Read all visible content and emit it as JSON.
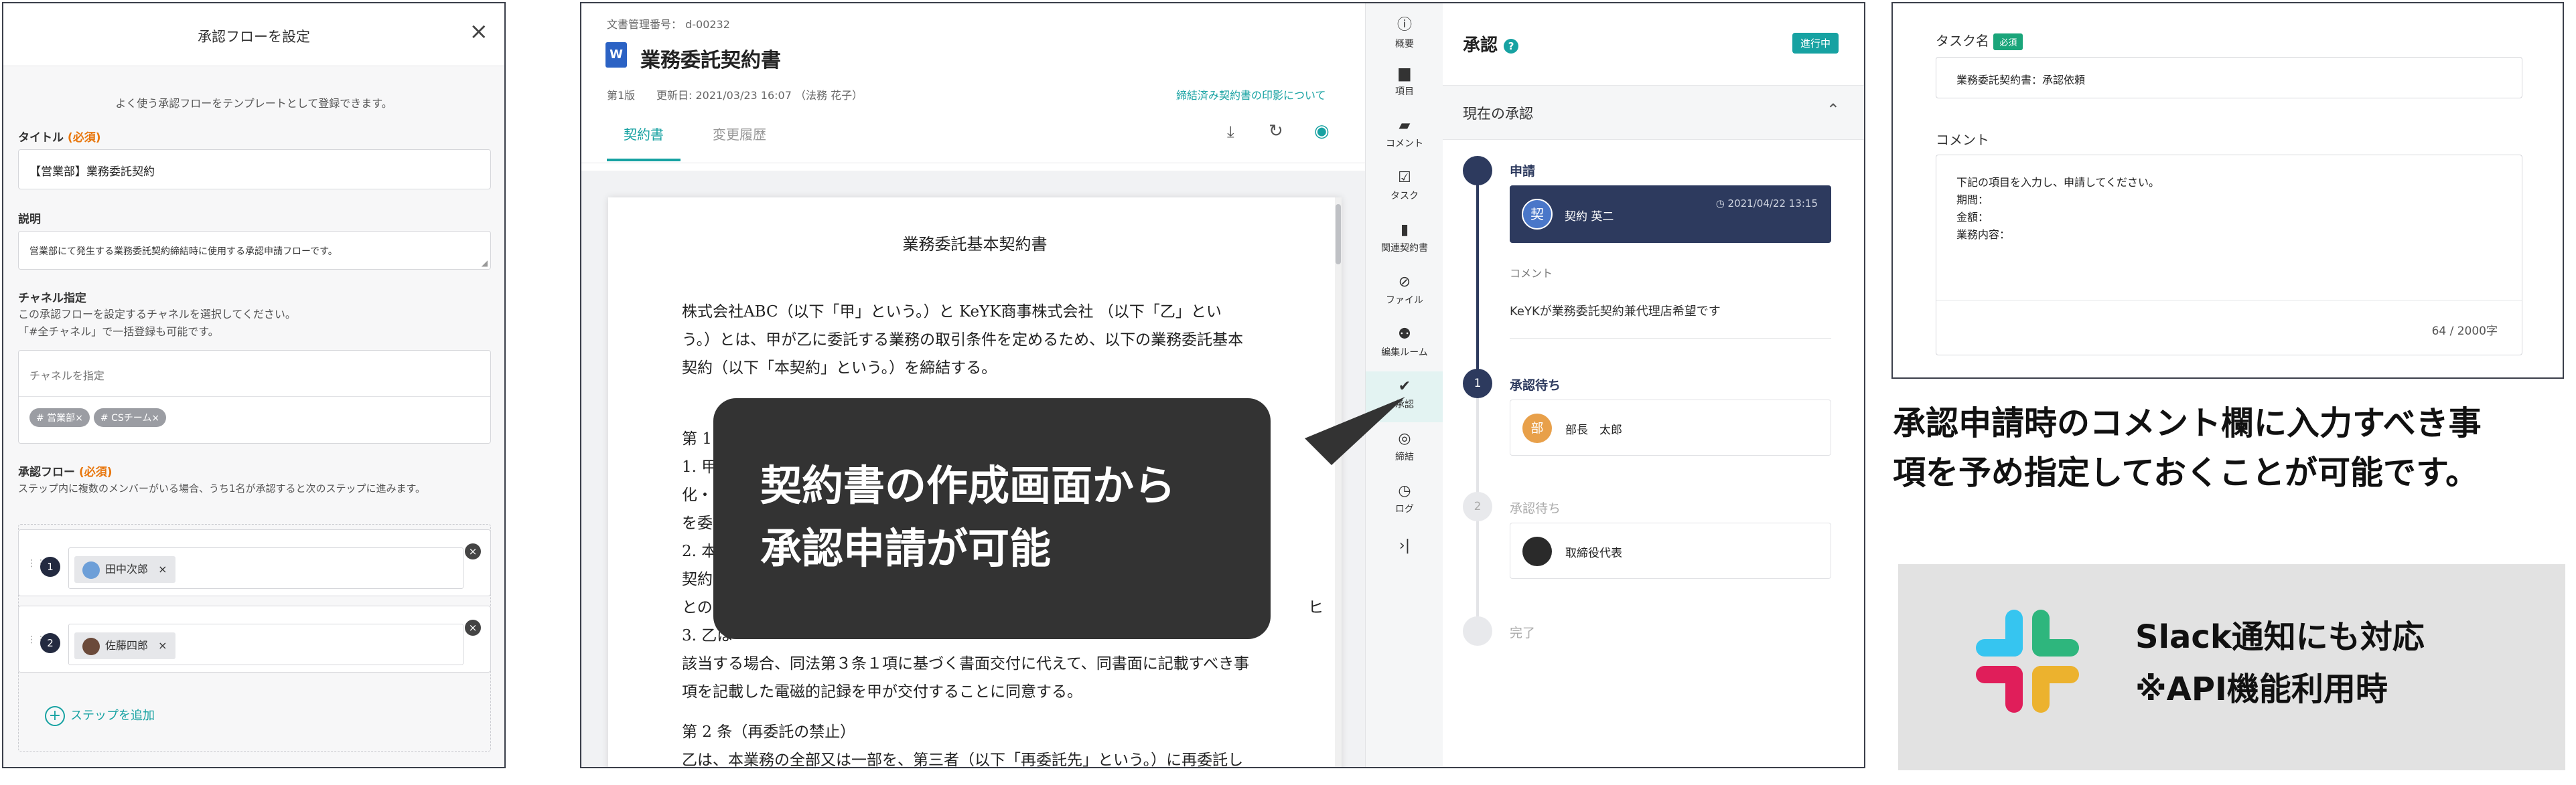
{
  "left": {
    "title": "承認フローを設定",
    "close": "×",
    "intro": "よく使う承認フローをテンプレートとして登録できます。",
    "title_label": "タイトル",
    "required": "(必須)",
    "title_value": "【営業部】業務委託契約",
    "desc_label": "説明",
    "desc_value": "営業部にて発生する業務委託契約締結時に使用する承認申請フローです。",
    "channel_label": "チャネル指定",
    "channel_help_1": "この承認フローを設定するチャネルを選択してください。",
    "channel_help_2": "「#全チャネル」で一括登録も可能です。",
    "channel_placeholder": "チャネルを指定",
    "channels": [
      "# 営業部",
      "# CSチーム"
    ],
    "flow_label": "承認フロー",
    "flow_help": "ステップ内に複数のメンバーがいる場合、うち1名が承認すると次のステップに進みます。",
    "steps": [
      {
        "num": "1",
        "person": "田中次郎"
      },
      {
        "num": "2",
        "person": "佐藤四郎"
      }
    ],
    "add_step": "ステップを追加"
  },
  "doc": {
    "manage_no": "文書管理番号： d-00232",
    "title": "業務委託契約書",
    "version": "第1版",
    "updated": "更新日: 2021/03/23 16:07 （法務 花子）",
    "print_link": "締結済み契約書の印影について",
    "tabs": [
      "契約書",
      "変更履歴"
    ],
    "heading": "業務委託基本契約書",
    "p1": [
      "株式会社ABC（以下「甲」という。）と KeYK商事株式会社 （以下「乙」とい",
      "う。）とは、甲が乙に委託する業務の取引条件を定めるため、以下の業務委託基本",
      "契約（以下「本契約」という。）を締結する。"
    ],
    "p2": [
      "第 1 条",
      "1. 甲は",
      "化・デ",
      "を委託し",
      "2. 本業",
      "契約で定",
      "との間に",
      "3. 乙は"
    ],
    "p2_right": [
      "ヒ"
    ],
    "p3": [
      "該当する場合、同法第３条１項に基づく書面交付に代えて、同書面に記載すべき事",
      "項を記載した電磁的記録を甲が交付することに同意する。"
    ],
    "p4": [
      "第 2 条（再委託の禁止）",
      "乙は、本業務の全部又は一部を、第三者（以下「再委託先」という。）に再委託し"
    ]
  },
  "sidebar_icons": [
    {
      "label": "概要",
      "icon": "info-icon",
      "glyph": "ⓘ"
    },
    {
      "label": "項目",
      "icon": "folder-icon",
      "glyph": "▆"
    },
    {
      "label": "コメント",
      "icon": "comment-icon",
      "glyph": "▰"
    },
    {
      "label": "タスク",
      "icon": "task-icon",
      "glyph": "☑"
    },
    {
      "label": "関連契約書",
      "icon": "document-icon",
      "glyph": "▮"
    },
    {
      "label": "ファイル",
      "icon": "paperclip-icon",
      "glyph": "⊘"
    },
    {
      "label": "編集ルーム",
      "icon": "people-icon",
      "glyph": "⚉"
    },
    {
      "label": "承認",
      "icon": "approval-icon",
      "glyph": "✔"
    },
    {
      "label": "締結",
      "icon": "seal-icon",
      "glyph": "◎"
    },
    {
      "label": "ログ",
      "icon": "clock-icon",
      "glyph": "◷"
    },
    {
      "label": "",
      "icon": "collapse-icon",
      "glyph": "›|"
    }
  ],
  "approval": {
    "title": "承認",
    "status": "進行中",
    "current": "現在の承認",
    "apply_label": "申請",
    "applicant": "契約 英二",
    "applicant_avatar": "契",
    "applied_at": "2021/04/22 13:15",
    "comment_label": "コメント",
    "comment": "KeYKが業務委託契約兼代理店希望です",
    "waiting_label": "承認待ち",
    "waiting_num": "1",
    "waiting_person": "部長　太郎",
    "waiting_avatar": "部",
    "next_num": "2",
    "next_label": "承認待ち",
    "next_person": "取締役代表",
    "done_label": "完了"
  },
  "callout": [
    "契約書の作成画面から",
    "承認申請が可能"
  ],
  "task": {
    "name_label": "タスク名",
    "required": "必須",
    "name_value": "業務委託契約書：承認依頼",
    "comment_label": "コメント",
    "comment_lines": [
      "下記の項目を入力し、申請してください。",
      "期間：",
      "金額：",
      "業務内容："
    ],
    "counter": "64 / 2000字"
  },
  "right_text": [
    "承認申請時のコメント欄に入力すべき事",
    "項を予め指定しておくことが可能です。"
  ],
  "slack": [
    "Slack通知にも対応",
    "※API機能利用時"
  ],
  "colors": {
    "accent": "#17a2a2",
    "navy": "#2d3a5e",
    "required": "#e8760c",
    "success": "#1aa57a"
  }
}
